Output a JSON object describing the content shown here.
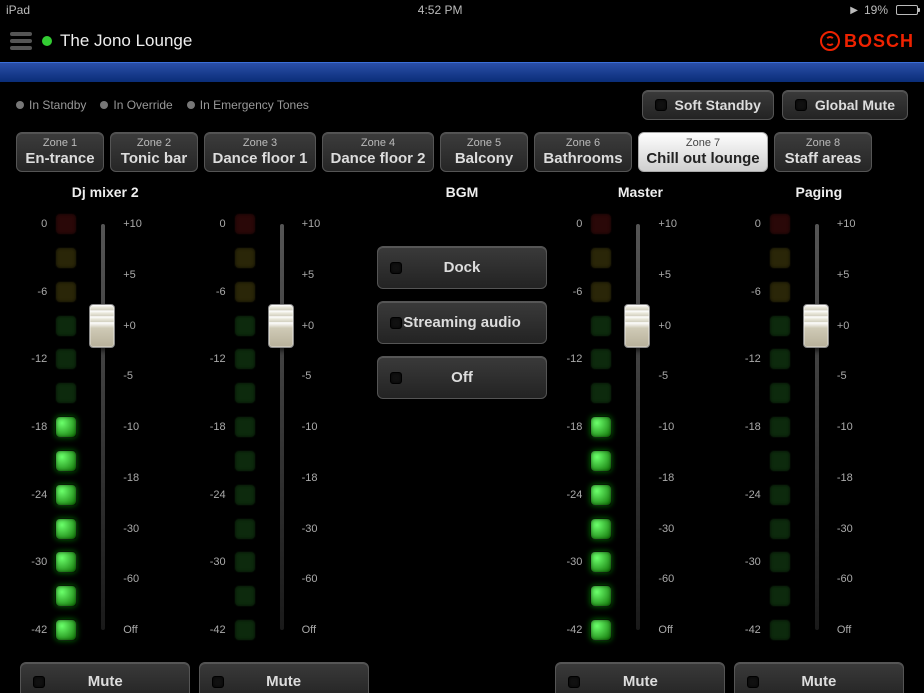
{
  "statusbar": {
    "device": "iPad",
    "time": "4:52 PM",
    "battery_pct": "19%"
  },
  "header": {
    "title": "The Jono Lounge",
    "brand": "BOSCH"
  },
  "legend": {
    "standby": "In Standby",
    "override": "In Override",
    "emergency": "In Emergency Tones"
  },
  "actions": {
    "soft_standby": "Soft Standby",
    "global_mute": "Global Mute"
  },
  "zones": [
    {
      "label": "Zone 1",
      "name": "En-trance",
      "selected": false
    },
    {
      "label": "Zone 2",
      "name": "Tonic bar",
      "selected": false
    },
    {
      "label": "Zone 3",
      "name": "Dance floor 1",
      "selected": false
    },
    {
      "label": "Zone 4",
      "name": "Dance floor 2",
      "selected": false
    },
    {
      "label": "Zone 5",
      "name": "Balcony",
      "selected": false
    },
    {
      "label": "Zone 6",
      "name": "Bathrooms",
      "selected": false
    },
    {
      "label": "Zone 7",
      "name": "Chill out lounge",
      "selected": true
    },
    {
      "label": "Zone 8",
      "name": "Staff areas",
      "selected": false
    }
  ],
  "channel_names": {
    "dj": "Dj mixer 2",
    "bgm": "BGM",
    "master": "Master",
    "paging": "Paging"
  },
  "bgm_options": [
    "Dock",
    "Streaming audio",
    "Off"
  ],
  "mute_label": "Mute",
  "meter_ticks": [
    "0",
    "-6",
    "-12",
    "-18",
    "-24",
    "-30",
    "-42"
  ],
  "db_scale": [
    "+10",
    "+5",
    "+0",
    "-5",
    "-10",
    "-18",
    "-30",
    "-60",
    "Off"
  ],
  "channels": {
    "dj": {
      "fader_db": "+0",
      "lit_from_bottom": 7
    },
    "master": {
      "fader_db": "+0",
      "lit_from_bottom": 7
    },
    "paging": {
      "fader_db": "+0",
      "lit_from_bottom": 0
    }
  }
}
